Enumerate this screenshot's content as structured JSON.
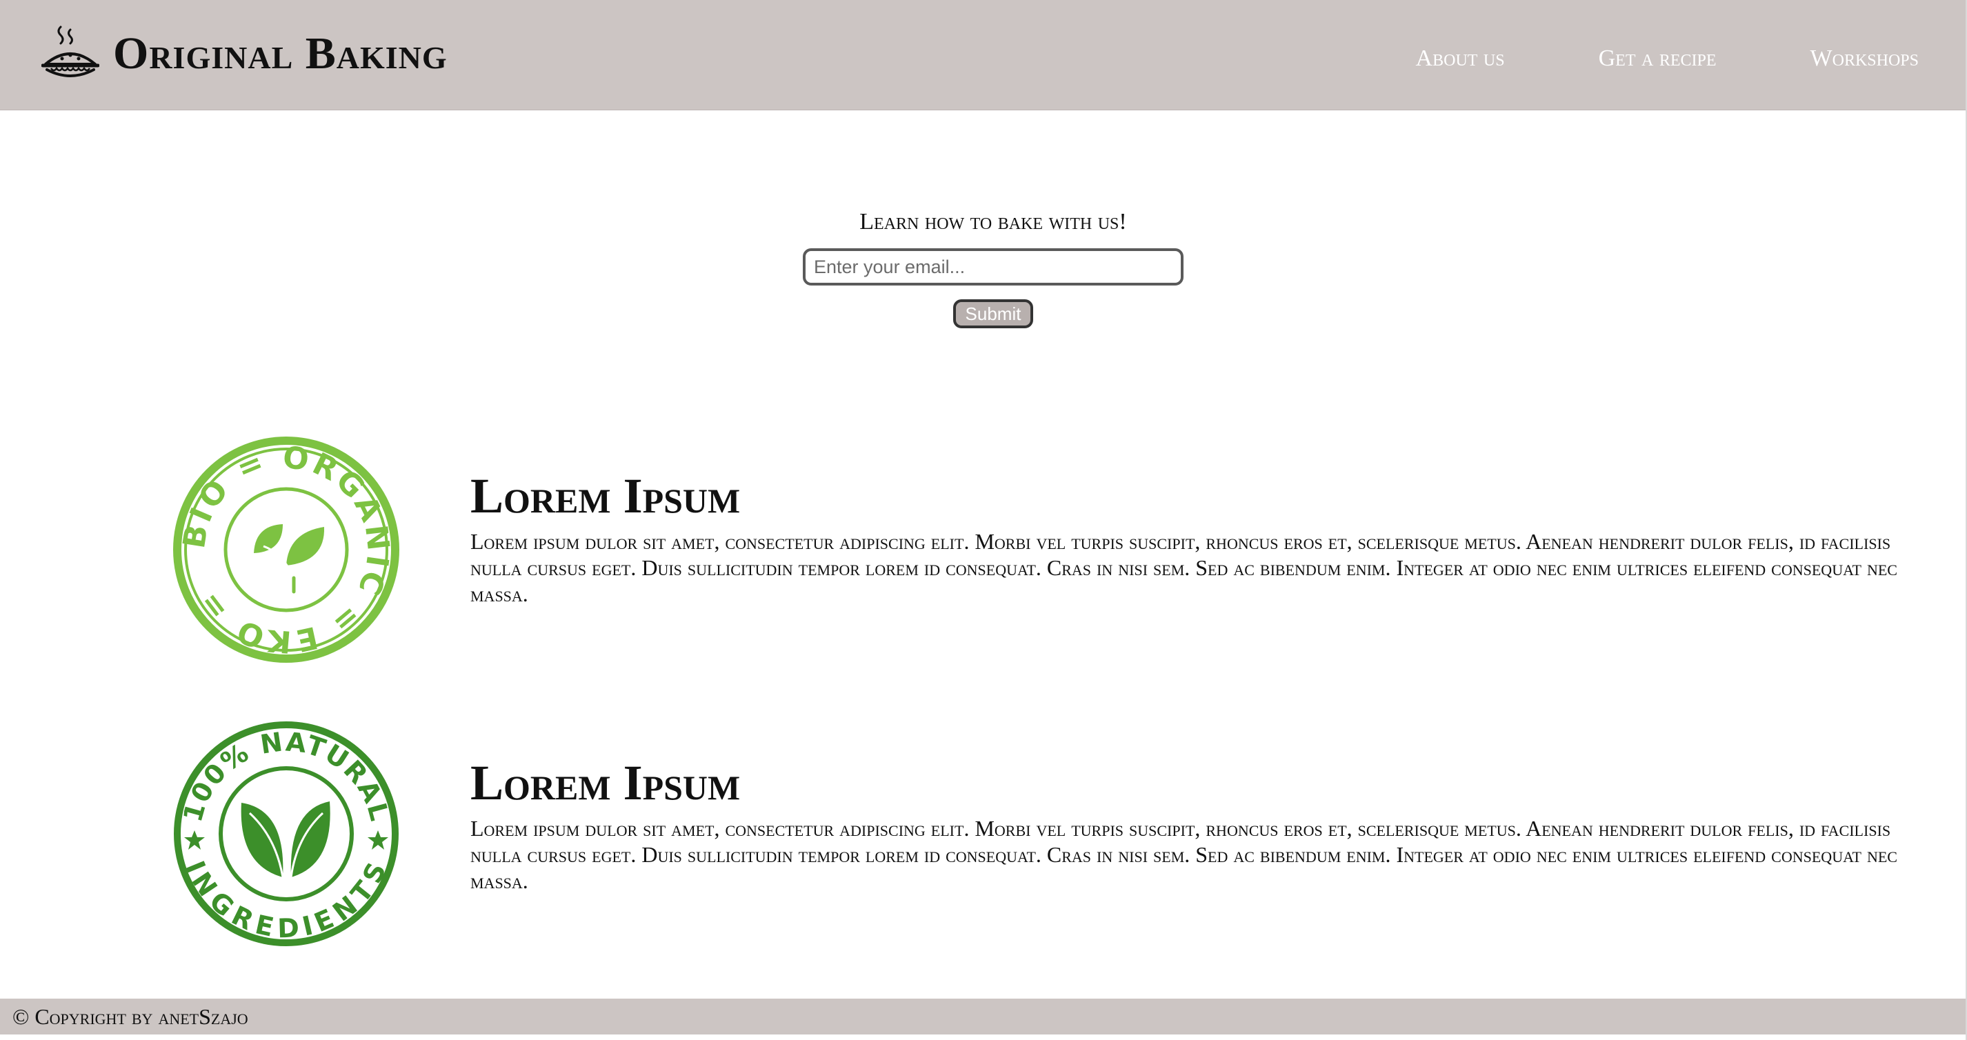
{
  "header": {
    "brand": "Original Baking",
    "logo_icon": "pie-icon",
    "nav": [
      {
        "label": "About us"
      },
      {
        "label": "Get a recipe"
      },
      {
        "label": "Workshops"
      }
    ]
  },
  "subscribe": {
    "title": "Learn how to bake with us!",
    "email_placeholder": "Enter your email...",
    "submit_label": "Submit"
  },
  "features": [
    {
      "badge_icon": "bio-organic-eko-stamp-icon",
      "badge_text": "BIO = ORGANIC = EKO =",
      "title": "Lorem Ipsum",
      "body": "Lorem ipsum dulor sit amet, consectetur adipiscing elit. Morbi vel turpis suscipit, rhoncus eros et, scelerisque metus. Aenean hendrerit dulor felis, id facilisis nulla cursus eget. Duis sullicitudin tempor lorem id consequat. Cras in nisi sem. Sed ac bibendum enim. Integer at odio nec enim ultrices eleifend consequat nec massa."
    },
    {
      "badge_icon": "natural-ingredients-stamp-icon",
      "badge_top_text": "100% NATURAL",
      "badge_bottom_text": "INGREDIENTS",
      "title": "Lorem Ipsum",
      "body": "Lorem ipsum dulor sit amet, consectetur adipiscing elit. Morbi vel turpis suscipit, rhoncus eros et, scelerisque metus. Aenean hendrerit dulor felis, id facilisis nulla cursus eget. Duis sullicitudin tempor lorem id consequat. Cras in nisi sem. Sed ac bibendum enim. Integer at odio nec enim ultrices eleifend consequat nec massa."
    }
  ],
  "footer": {
    "copyright": "© Copyright by anetSzajo"
  },
  "colors": {
    "header_bg": "#ccc5c3",
    "nav_text": "#ffffff",
    "light_green": "#7dc242",
    "dark_green": "#3c8f2a",
    "button_bg": "#b8b0ae"
  }
}
